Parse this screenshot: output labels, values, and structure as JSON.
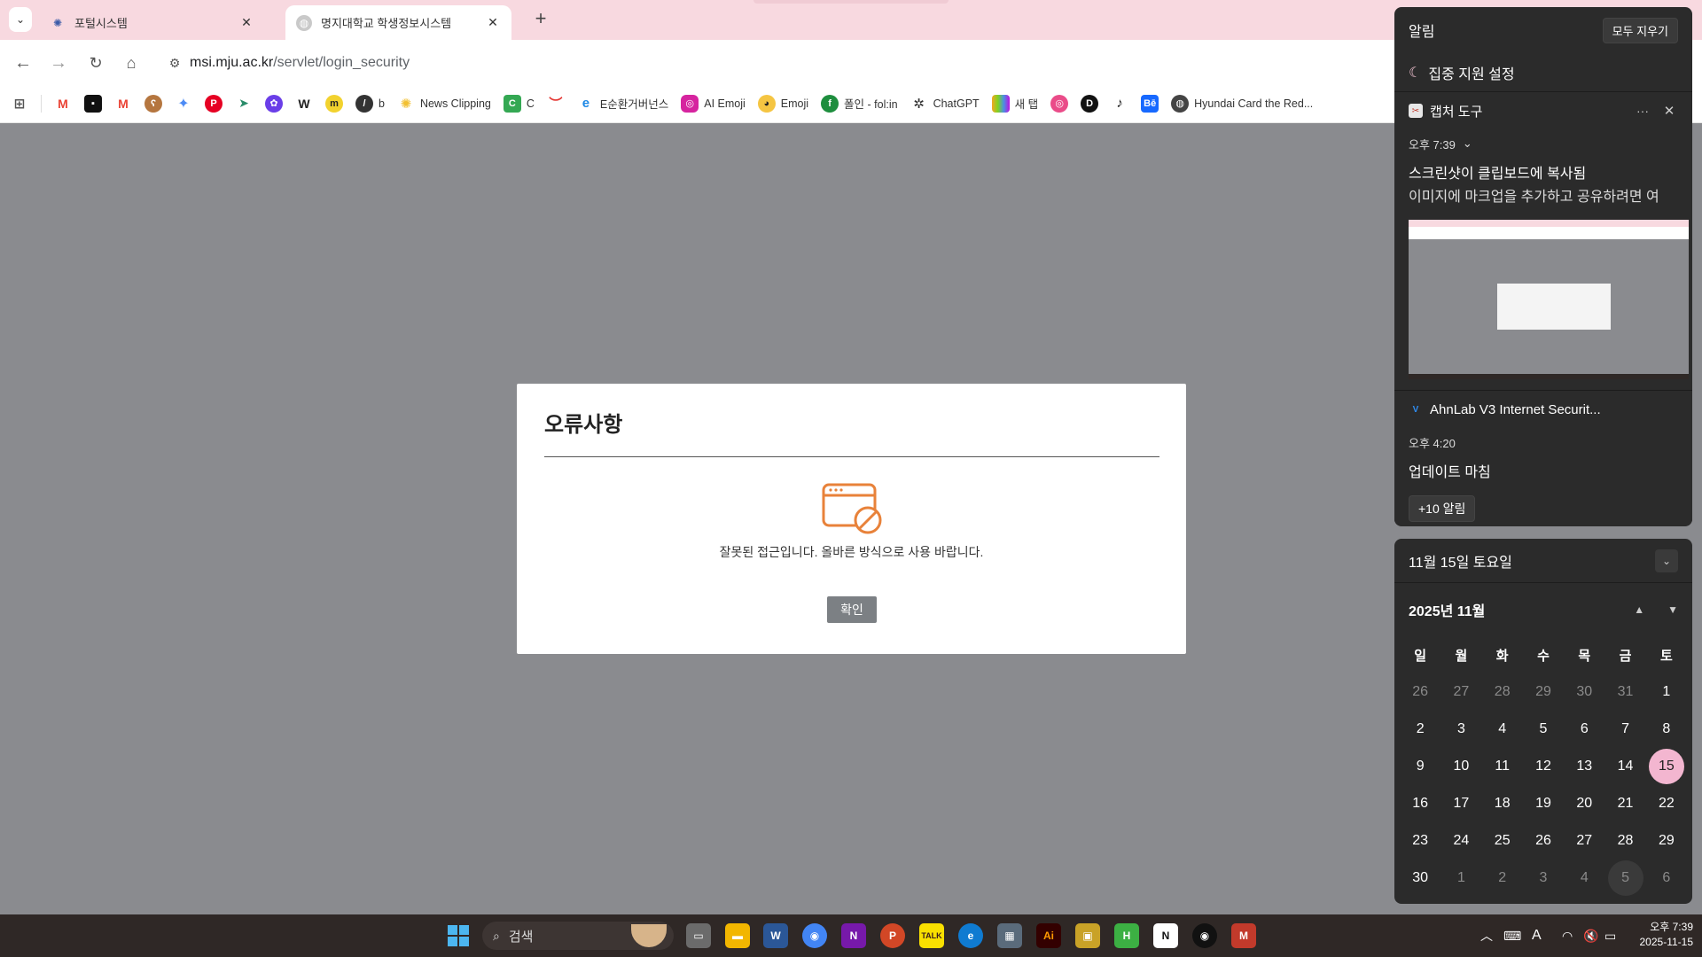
{
  "browser": {
    "tabs": [
      {
        "title": "포털시스템",
        "active": false
      },
      {
        "title": "명지대학교 학생정보시스템",
        "active": true
      }
    ],
    "url_host": "msi.mju.ac.kr",
    "url_path": "/servlet/login_security",
    "bookmarks": [
      {
        "icon": "gmail-icon",
        "label": ""
      },
      {
        "icon": "black-square-icon",
        "label": ""
      },
      {
        "icon": "gmail-icon",
        "label": ""
      },
      {
        "icon": "bear-icon",
        "label": ""
      },
      {
        "icon": "gemini-icon",
        "label": ""
      },
      {
        "icon": "pinterest-icon",
        "label": ""
      },
      {
        "icon": "arrow-icon",
        "label": ""
      },
      {
        "icon": "purple-flower-icon",
        "label": ""
      },
      {
        "icon": "w-icon",
        "label": ""
      },
      {
        "icon": "m-icon",
        "label": ""
      },
      {
        "icon": "slash-icon",
        "label": "b"
      },
      {
        "icon": "news-icon",
        "label": "News Clipping"
      },
      {
        "icon": "c-icon",
        "label": "C"
      },
      {
        "icon": "red-wave-icon",
        "label": ""
      },
      {
        "icon": "e-icon",
        "label": "E순환거버넌스"
      },
      {
        "icon": "instagram-icon",
        "label": "AI Emoji"
      },
      {
        "icon": "duck-icon",
        "label": "Emoji"
      },
      {
        "icon": "folin-icon",
        "label": "폴인 - fol:in"
      },
      {
        "icon": "chatgpt-icon",
        "label": "ChatGPT"
      },
      {
        "icon": "colorbars-icon",
        "label": "새 탭"
      },
      {
        "icon": "dribbble-icon",
        "label": ""
      },
      {
        "icon": "d-icon",
        "label": ""
      },
      {
        "icon": "tiktok-icon",
        "label": ""
      },
      {
        "icon": "behance-icon",
        "label": ""
      },
      {
        "icon": "globe-icon",
        "label": "Hyundai Card the Red..."
      }
    ]
  },
  "modal": {
    "title": "오류사항",
    "message": "잘못된 접근입니다. 올바른 방식으로 사용 바랍니다.",
    "confirm_label": "확인"
  },
  "notifications": {
    "header": "알림",
    "clear_all": "모두 지우기",
    "focus": "집중 지원 설정",
    "items": [
      {
        "app": "캡처 도구",
        "time": "오후 7:39",
        "title": "스크린샷이 클립보드에 복사됨",
        "body": "이미지에 마크업을 추가하고 공유하려면 여"
      },
      {
        "app": "AhnLab V3 Internet Securit...",
        "time": "오후 4:20",
        "title": "업데이트 마침",
        "body": ""
      }
    ],
    "more_label": "+10 알림"
  },
  "calendar": {
    "date_header": "11월 15일 토요일",
    "month_label": "2025년 11월",
    "weekdays": [
      "일",
      "월",
      "화",
      "수",
      "목",
      "금",
      "토"
    ],
    "days": [
      {
        "n": "26",
        "out": true
      },
      {
        "n": "27",
        "out": true
      },
      {
        "n": "28",
        "out": true
      },
      {
        "n": "29",
        "out": true
      },
      {
        "n": "30",
        "out": true
      },
      {
        "n": "31",
        "out": true
      },
      {
        "n": "1",
        "out": false
      },
      {
        "n": "2",
        "out": false
      },
      {
        "n": "3",
        "out": false
      },
      {
        "n": "4",
        "out": false
      },
      {
        "n": "5",
        "out": false
      },
      {
        "n": "6",
        "out": false
      },
      {
        "n": "7",
        "out": false
      },
      {
        "n": "8",
        "out": false
      },
      {
        "n": "9",
        "out": false
      },
      {
        "n": "10",
        "out": false
      },
      {
        "n": "11",
        "out": false
      },
      {
        "n": "12",
        "out": false
      },
      {
        "n": "13",
        "out": false
      },
      {
        "n": "14",
        "out": false
      },
      {
        "n": "15",
        "out": false,
        "today": true
      },
      {
        "n": "16",
        "out": false
      },
      {
        "n": "17",
        "out": false
      },
      {
        "n": "18",
        "out": false
      },
      {
        "n": "19",
        "out": false
      },
      {
        "n": "20",
        "out": false
      },
      {
        "n": "21",
        "out": false
      },
      {
        "n": "22",
        "out": false
      },
      {
        "n": "23",
        "out": false
      },
      {
        "n": "24",
        "out": false
      },
      {
        "n": "25",
        "out": false
      },
      {
        "n": "26",
        "out": false
      },
      {
        "n": "27",
        "out": false
      },
      {
        "n": "28",
        "out": false
      },
      {
        "n": "29",
        "out": false
      },
      {
        "n": "30",
        "out": false
      },
      {
        "n": "1",
        "out": true
      },
      {
        "n": "2",
        "out": true
      },
      {
        "n": "3",
        "out": true
      },
      {
        "n": "4",
        "out": true
      },
      {
        "n": "5",
        "out": true,
        "highlight": true
      },
      {
        "n": "6",
        "out": true
      }
    ]
  },
  "taskbar": {
    "search_placeholder": "검색",
    "ime": "A",
    "time": "오후 7:39",
    "date": "2025-11-15"
  },
  "colors": {
    "accent_orange": "#e8823a",
    "tabbar_pink": "#f8d9e0",
    "today_pink": "#f3b6d0",
    "confirm_gray": "#7c8084"
  }
}
